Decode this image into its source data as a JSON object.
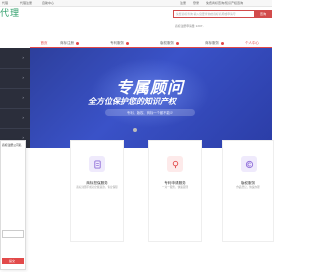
{
  "topbar": {
    "items": [
      "代理",
      "代理注册",
      "自助中心"
    ],
    "right_links": [
      "注册",
      "登录",
      "免费商标查询/知识产权咨询"
    ]
  },
  "header": {
    "logo_text": "代理",
    "search_placeholder": "免费商标查询 输入您要查询的商标名称或申请号",
    "search_button": "查询",
    "stats_text": "商标注册申请量 1207,"
  },
  "nav": {
    "items": [
      {
        "label": "首页",
        "active": true
      },
      {
        "label": "商标注册"
      },
      {
        "label": "专利服务"
      },
      {
        "label": "版权服务"
      },
      {
        "label": "商标服务"
      },
      {
        "label": "个人中心"
      }
    ]
  },
  "sidemenu": {
    "rows": 5
  },
  "banner": {
    "title": "专属顾问",
    "subtitle": "全方位保护您的知识产权",
    "pill_text": "专利、版权、商标一个都不能少"
  },
  "float_panel": {
    "title": "商标注册公司名",
    "button_text": "提交"
  },
  "cards": [
    {
      "title": "商标担保服务",
      "desc": "商标注册不成功全额退款，专业保障",
      "accent": "#8e6cd8",
      "icon": "trademark-icon"
    },
    {
      "title": "专利申请服务",
      "desc": "一对一服务，快速受理",
      "accent": "#e24a4a",
      "icon": "patent-icon"
    },
    {
      "title": "版权服务",
      "desc": "作品登记，快速办理",
      "accent": "#8e6cd8",
      "icon": "copyright-icon"
    }
  ],
  "colors": {
    "accent": "#e24a4a",
    "banner": "#3a52c8",
    "sidebar": "#2b2e3b"
  }
}
